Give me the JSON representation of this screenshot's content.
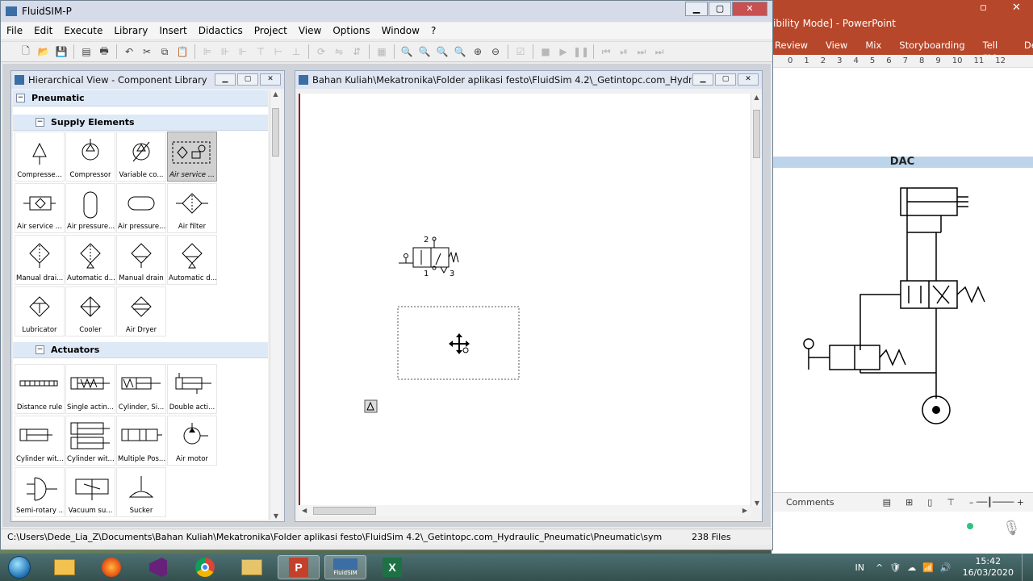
{
  "app": {
    "title": "FluidSIM-P"
  },
  "menu": [
    "File",
    "Edit",
    "Execute",
    "Library",
    "Insert",
    "Didactics",
    "Project",
    "View",
    "Options",
    "Window",
    "?"
  ],
  "library_window": {
    "title": "Hierarchical View - Component Library",
    "root": "Pneumatic",
    "groups": [
      {
        "name": "Supply Elements",
        "items": [
          {
            "label": "Compresse...",
            "icon": "compressed-air-source-icon"
          },
          {
            "label": "Compressor",
            "icon": "compressor-icon"
          },
          {
            "label": "Variable co...",
            "icon": "variable-compressor-icon"
          },
          {
            "label": "Air service ...",
            "icon": "air-service-unit-icon",
            "selected": true
          },
          {
            "label": "Air service ...",
            "icon": "air-service-unit-simplified-icon"
          },
          {
            "label": "Air pressure...",
            "icon": "air-pressure-reservoir-icon"
          },
          {
            "label": "Air pressure...",
            "icon": "air-pressure-reservoir-2-icon"
          },
          {
            "label": "Air filter",
            "icon": "air-filter-icon"
          },
          {
            "label": "Manual drai...",
            "icon": "manual-drain-filter-icon"
          },
          {
            "label": "Automatic d...",
            "icon": "automatic-drain-filter-icon"
          },
          {
            "label": "Manual drain",
            "icon": "manual-drain-icon"
          },
          {
            "label": "Automatic d...",
            "icon": "automatic-drain-icon"
          },
          {
            "label": "Lubricator",
            "icon": "lubricator-icon"
          },
          {
            "label": "Cooler",
            "icon": "cooler-icon"
          },
          {
            "label": "Air Dryer",
            "icon": "air-dryer-icon"
          }
        ]
      },
      {
        "name": "Actuators",
        "items": [
          {
            "label": "Distance rule",
            "icon": "distance-rule-icon"
          },
          {
            "label": "Single actin...",
            "icon": "single-acting-cylinder-icon"
          },
          {
            "label": "Cylinder, Si...",
            "icon": "cylinder-single-icon"
          },
          {
            "label": "Double acti...",
            "icon": "double-acting-cylinder-icon"
          },
          {
            "label": "Cylinder wit...",
            "icon": "cylinder-with-icon"
          },
          {
            "label": "Cylinder wit...",
            "icon": "cylinder-with-2-icon"
          },
          {
            "label": "Multiple Pos...",
            "icon": "multiple-position-cylinder-icon"
          },
          {
            "label": "Air motor",
            "icon": "air-motor-icon"
          },
          {
            "label": "Semi-rotary ...",
            "icon": "semi-rotary-actuator-icon"
          },
          {
            "label": "Vacuum su...",
            "icon": "vacuum-suction-icon"
          },
          {
            "label": "Sucker",
            "icon": "sucker-icon"
          }
        ]
      }
    ]
  },
  "doc_window": {
    "title": "Bahan Kuliah\\Mekatronika\\Folder aplikasi festo\\FluidSim 4.2\\_Getintopc.com_Hydraulic_Pn...",
    "valve_ports": {
      "p2": "2",
      "p1": "1",
      "p3": "3"
    }
  },
  "status": {
    "path": "C:\\Users\\Dede_Lia_Z\\Documents\\Bahan Kuliah\\Mekatronika\\Folder aplikasi festo\\FluidSim 4.2\\_Getintopc.com_Hydraulic_Pneumatic\\Pneumatic\\sym",
    "files": "238 Files"
  },
  "ppt": {
    "title": "ibility Mode] - PowerPoint",
    "tabs": [
      "Review",
      "View",
      "Mix",
      "Storyboarding",
      "Tell me...",
      "Dede"
    ],
    "ruler": [
      "0",
      "1",
      "2",
      "3",
      "4",
      "5",
      "6",
      "7",
      "8",
      "9",
      "10",
      "11",
      "12"
    ],
    "slide_heading": "DAC",
    "comments": "Comments"
  },
  "taskbar": {
    "apps": [
      "start-orb",
      "file-explorer",
      "firefox",
      "visual-studio",
      "chrome",
      "folder",
      "powerpoint",
      "fluidsim",
      "excel"
    ],
    "fluidsim_label": "FluidSIM",
    "lang": "IN",
    "time": "15:42",
    "date": "16/03/2020"
  }
}
